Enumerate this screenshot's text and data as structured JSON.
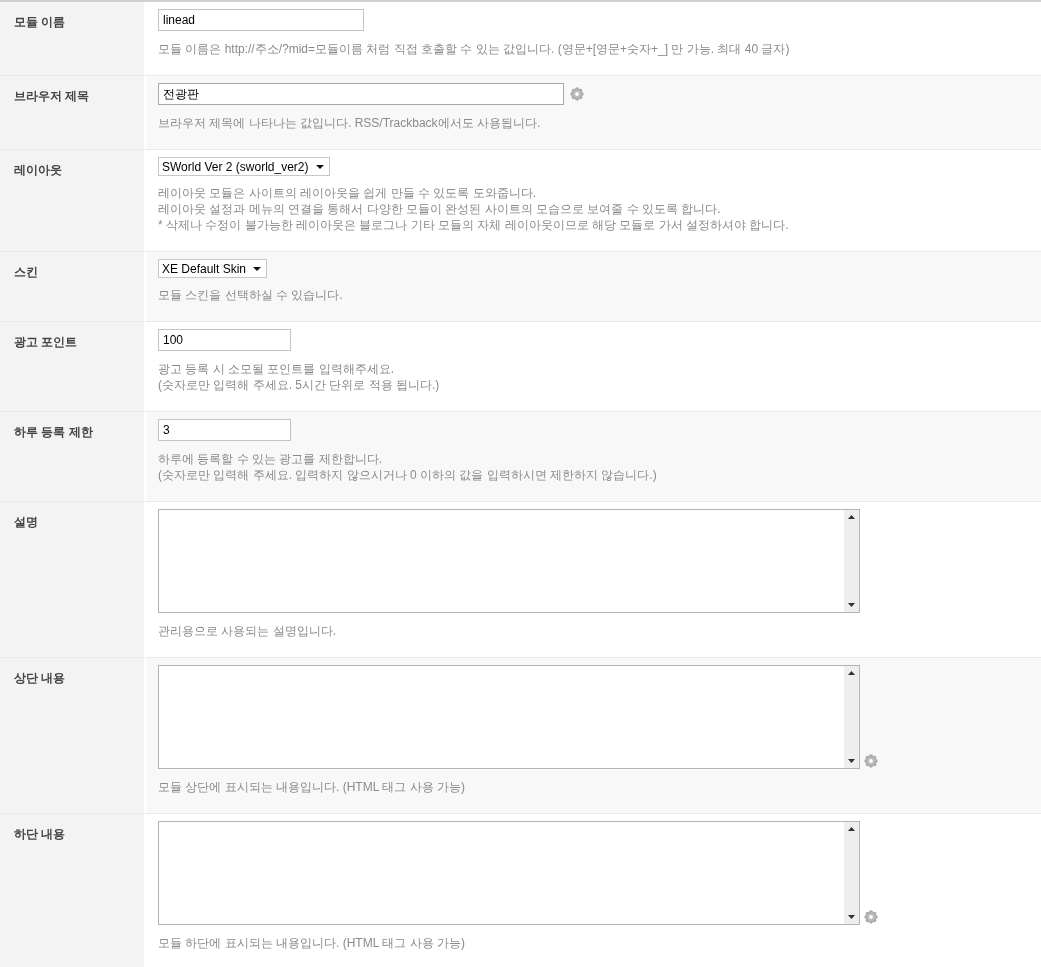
{
  "fields": [
    {
      "label": "모듈 이름",
      "kind": "text",
      "value": "linead",
      "options_button": false,
      "help": [
        "모듈 이름은 http://주소/?mid=모듈이름 처럼 직접 호출할 수 있는 값입니다. (영문+[영문+숫자+_] 만 가능. 최대 40 글자)"
      ]
    },
    {
      "label": "브라우저 제목",
      "kind": "wide_text",
      "value": "전광판",
      "options_button": true,
      "help": [
        "브라우저 제목에 나타나는 값입니다. RSS/Trackback에서도 사용됩니다."
      ]
    },
    {
      "label": "레이아웃",
      "kind": "select",
      "value": "SWorld Ver 2 (sworld_ver2)",
      "options_button": false,
      "help": [
        "레이아웃 모듈은 사이트의 레이아웃을 쉽게 만들 수 있도록 도와줍니다.",
        "레이아웃 설정과 메뉴의 연결을 통해서 다양한 모듈이 완성된 사이트의 모습으로 보여줄 수 있도록 합니다.",
        "* 삭제나 수정이 불가능한 레이아웃은 블로그나 기타 모듈의 자체 레이아웃이므로 해당 모듈로 가서 설정하셔야 합니다."
      ]
    },
    {
      "label": "스킨",
      "kind": "select",
      "value": "XE Default Skin",
      "options_button": false,
      "help": [
        "모듈 스킨을 선택하실 수 있습니다."
      ]
    },
    {
      "label": "광고 포인트",
      "kind": "number",
      "value": "100",
      "options_button": false,
      "help": [
        "광고 등록 시 소모될 포인트를 입력해주세요.",
        "(숫자로만 입력해 주세요. 5시간 단위로 적용 됩니다.)"
      ]
    },
    {
      "label": "하루 등록 제한",
      "kind": "number",
      "value": "3",
      "options_button": false,
      "help": [
        "하루에 등록할 수 있는 광고를 제한합니다.",
        "(숫자로만 입력해 주세요. 입력하지 않으시거나 0 이하의 값을 입력하시면 제한하지 않습니다.)"
      ]
    },
    {
      "label": "설명",
      "kind": "textarea",
      "options_button": false,
      "help": [
        "관리용으로 사용되는 설명입니다."
      ]
    },
    {
      "label": "상단 내용",
      "kind": "textarea",
      "options_button": true,
      "help": [
        "모듈 상단에 표시되는 내용입니다. (HTML 태그 사용 가능)"
      ]
    },
    {
      "label": "하단 내용",
      "kind": "textarea",
      "options_button": true,
      "help": [
        "모듈 하단에 표시되는 내용입니다. (HTML 태그 사용 가능)"
      ]
    }
  ]
}
